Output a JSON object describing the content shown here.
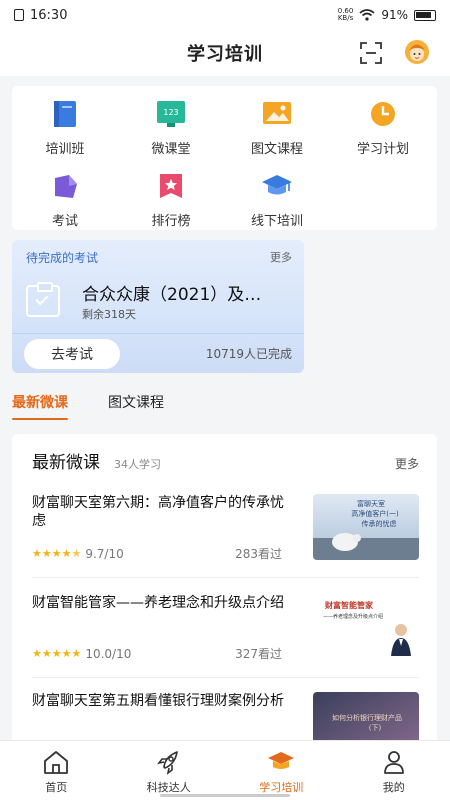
{
  "status_bar": {
    "time": "16:30",
    "net_speed_value": "0.60",
    "net_speed_unit": "KB/s",
    "battery": "91%"
  },
  "header": {
    "title": "学习培训"
  },
  "grid": [
    {
      "label": "培训班",
      "icon": "book-icon"
    },
    {
      "label": "微课堂",
      "icon": "board-icon"
    },
    {
      "label": "图文课程",
      "icon": "image-icon"
    },
    {
      "label": "学习计划",
      "icon": "clock-icon"
    },
    {
      "label": "考试",
      "icon": "exam-icon"
    },
    {
      "label": "排行榜",
      "icon": "ranking-icon"
    },
    {
      "label": "线下培训",
      "icon": "graduation-cap-icon"
    }
  ],
  "board_icon_text": "123",
  "exam": {
    "heading": "待完成的考试",
    "more": "更多",
    "title": "合众众康（2021）及…",
    "remaining": "剩余318天",
    "button": "去考试",
    "completed": "10719人已完成"
  },
  "tabs": [
    {
      "label": "最新微课",
      "active": true
    },
    {
      "label": "图文课程",
      "active": false
    }
  ],
  "list": {
    "title": "最新微课",
    "count": "34人学习",
    "more": "更多",
    "courses": [
      {
        "title": "财富聊天室第六期：高净值客户的传承忧虑",
        "rating": "9.7/10",
        "stars": 4.5,
        "views": "283看过",
        "thumb_text": "富聊天室\n高净值客户(一)\n传承的忧虑"
      },
      {
        "title": "财富智能管家——养老理念和升级点介绍",
        "rating": "10.0/10",
        "stars": 5,
        "views": "327看过",
        "thumb_text": "财富智能管家\n——养老理念及升级点介绍"
      },
      {
        "title": "财富聊天室第五期看懂银行理财案例分析",
        "thumb_text": "如何分析银行理财产品\n(下)"
      }
    ]
  },
  "bottom_nav": [
    {
      "label": "首页",
      "icon": "home-icon",
      "active": false
    },
    {
      "label": "科技达人",
      "icon": "rocket-icon",
      "active": false
    },
    {
      "label": "学习培训",
      "icon": "mortarboard-icon",
      "active": true
    },
    {
      "label": "我的",
      "icon": "user-icon",
      "active": false
    }
  ],
  "colors": {
    "accent": "#e26a1a",
    "star": "#f3b414",
    "exam_blue": "#3b6fc9"
  }
}
